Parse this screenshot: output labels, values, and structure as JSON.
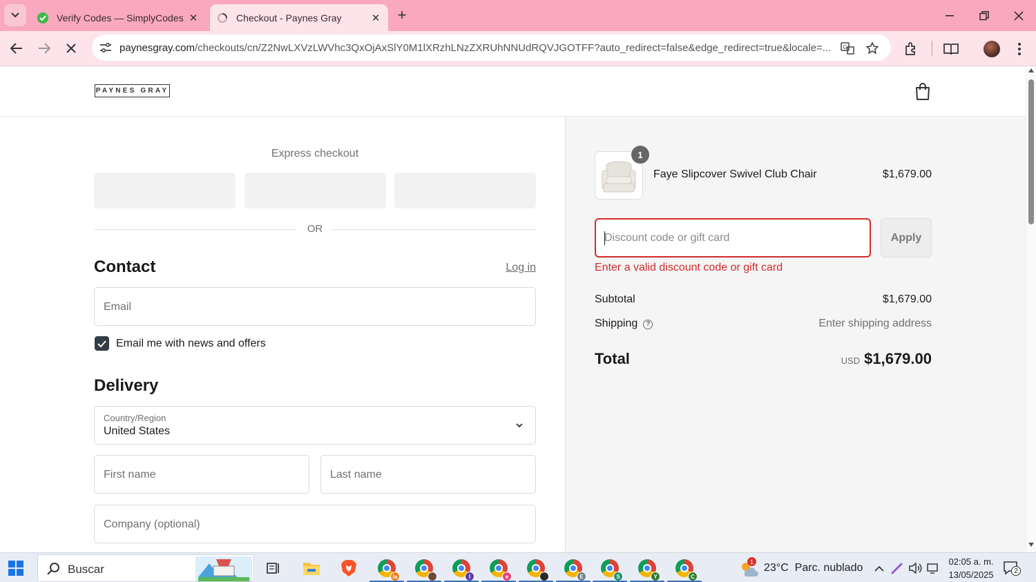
{
  "browser": {
    "tabs": [
      {
        "title": "Verify Codes — SimplyCodes",
        "active": false,
        "favicon": "simplycodes-icon"
      },
      {
        "title": "Checkout - Paynes Gray",
        "active": true,
        "favicon": "loading-spinner-icon"
      }
    ],
    "url_host": "paynesgray.com",
    "url_path": "/checkouts/cn/Z2NwLXVzLWVhc3QxOjAxSlY0M1lXRzhLNzZXRUhNNUdRQVJGOTFF?auto_redirect=false&edge_redirect=true&locale=..."
  },
  "site": {
    "logo_text": "PAYNES GRAY"
  },
  "checkout": {
    "express_title": "Express checkout",
    "or_text": "OR",
    "contact_heading": "Contact",
    "login_label": "Log in",
    "email_placeholder": "Email",
    "newsletter_label": "Email me with news and offers",
    "newsletter_checked": true,
    "delivery_heading": "Delivery",
    "country_label": "Country/Region",
    "country_value": "United States",
    "first_name_placeholder": "First name",
    "last_name_placeholder": "Last name",
    "company_placeholder": "Company (optional)"
  },
  "summary": {
    "product": {
      "name": "Faye Slipcover Swivel Club Chair",
      "price": "$1,679.00",
      "quantity": "1"
    },
    "discount_placeholder": "Discount code or gift card",
    "apply_label": "Apply",
    "error_text": "Enter a valid discount code or gift card",
    "subtotal_label": "Subtotal",
    "subtotal_value": "$1,679.00",
    "shipping_label": "Shipping",
    "shipping_value": "Enter shipping address",
    "total_label": "Total",
    "total_currency": "USD",
    "total_value": "$1,679.00",
    "error_color": "#d12c2c"
  },
  "taskbar": {
    "search_text": "Buscar",
    "weather_badge": "1",
    "weather_text": "23°C  Parc. nublado",
    "time": "02:05 a. m.",
    "date": "13/05/2025",
    "notification_count": "2",
    "chrome_profiles": [
      "la",
      "",
      "I",
      "e",
      "",
      "E",
      "S",
      "Y",
      "C"
    ]
  }
}
